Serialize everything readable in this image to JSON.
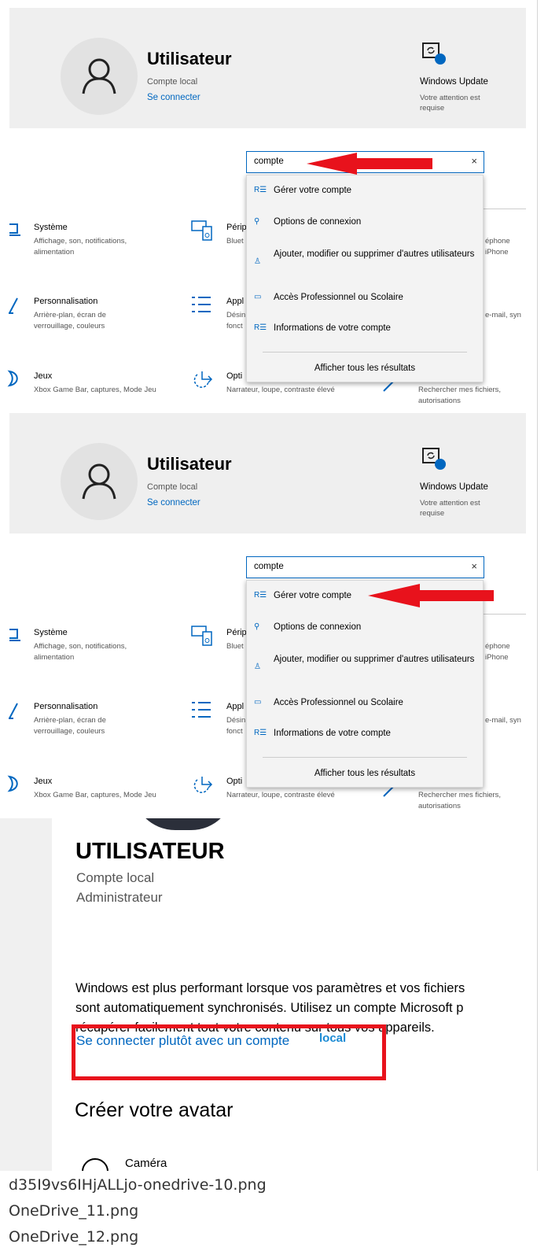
{
  "colors": {
    "accent": "#0067c0",
    "annotation": "#e8121c"
  },
  "panels": [
    {
      "user": {
        "name": "Utilisateur",
        "type": "Compte local",
        "link": "Se connecter"
      },
      "windows_update": {
        "icon": "windows-update-icon",
        "title": "Windows Update",
        "subtitle": "Votre attention est requise"
      },
      "tiles": [
        {
          "icon": "system-icon",
          "title": "Système",
          "subtitle": "Affichage, son, notifications, alimentation"
        },
        {
          "icon": "devices-icon",
          "title": "Périp",
          "subtitle": "Bluet"
        },
        {
          "icon": "phone-icon",
          "title": "éphone",
          "subtitle": "iPhone"
        },
        {
          "icon": "personalization-icon",
          "title": "Personnalisation",
          "subtitle": "Arrière-plan, écran de verrouillage, couleurs"
        },
        {
          "icon": "apps-icon",
          "title": "Appl",
          "subtitle": "Désin fonct"
        },
        {
          "icon": "accounts-icon",
          "title": "",
          "subtitle": "e-mail, syn"
        },
        {
          "icon": "gaming-icon",
          "title": "Jeux",
          "subtitle": "Xbox Game Bar, captures, Mode Jeu"
        },
        {
          "icon": "accessibility-icon",
          "title": "Opti",
          "subtitle": "Narrateur, loupe, contraste élevé"
        },
        {
          "icon": "search-icon",
          "title": "",
          "subtitle": "Rechercher mes fichiers, autorisations"
        }
      ],
      "search": {
        "value": "compte",
        "clear": "×"
      },
      "suggestions": [
        {
          "icon": "account-details-icon",
          "label": "Gérer votre compte"
        },
        {
          "icon": "key-icon",
          "label": "Options de connexion"
        },
        {
          "icon": "add-user-icon",
          "label": "Ajouter, modifier ou supprimer d'autres utilisateurs"
        },
        {
          "icon": "briefcase-icon",
          "label": "Accès Professionnel ou Scolaire"
        },
        {
          "icon": "account-details-icon",
          "label": "Informations de votre compte"
        }
      ],
      "show_all": "Afficher tous les résultats",
      "arrow_target": "search-input"
    },
    {
      "user": {
        "name": "Utilisateur",
        "type": "Compte local",
        "link": "Se connecter"
      },
      "windows_update": {
        "icon": "windows-update-icon",
        "title": "Windows Update",
        "subtitle": "Votre attention est requise"
      },
      "tiles": [
        {
          "icon": "system-icon",
          "title": "Système",
          "subtitle": "Affichage, son, notifications, alimentation"
        },
        {
          "icon": "devices-icon",
          "title": "Périp",
          "subtitle": "Bluet"
        },
        {
          "icon": "phone-icon",
          "title": "éphone",
          "subtitle": "iPhone"
        },
        {
          "icon": "personalization-icon",
          "title": "Personnalisation",
          "subtitle": "Arrière-plan, écran de verrouillage, couleurs"
        },
        {
          "icon": "apps-icon",
          "title": "Appl",
          "subtitle": "Désin fonct"
        },
        {
          "icon": "accounts-icon",
          "title": "",
          "subtitle": "e-mail, syn"
        },
        {
          "icon": "gaming-icon",
          "title": "Jeux",
          "subtitle": "Xbox Game Bar, captures, Mode Jeu"
        },
        {
          "icon": "accessibility-icon",
          "title": "Opti",
          "subtitle": "Narrateur, loupe, contraste élevé"
        },
        {
          "icon": "search-icon",
          "title": "",
          "subtitle": "Rechercher mes fichiers, autorisations"
        }
      ],
      "search": {
        "value": "compte",
        "clear": "×"
      },
      "suggestions": [
        {
          "icon": "account-details-icon",
          "label": "Gérer votre compte"
        },
        {
          "icon": "key-icon",
          "label": "Options de connexion"
        },
        {
          "icon": "add-user-icon",
          "label": "Ajouter, modifier ou supprimer d'autres utilisateurs"
        },
        {
          "icon": "briefcase-icon",
          "label": "Accès Professionnel ou Scolaire"
        },
        {
          "icon": "account-details-icon",
          "label": "Informations de votre compte"
        }
      ],
      "show_all": "Afficher tous les résultats",
      "arrow_target": "suggestion-gerer-votre-compte"
    }
  ],
  "account_page": {
    "name": "UTILISATEUR",
    "type": "Compte local",
    "role": "Administrateur",
    "paragraph": [
      "Windows est plus performant lorsque vos paramètres et vos fichiers",
      "sont automatiquement synchronisés. Utilisez un compte Microsoft p",
      "récupérer facilement tout votre contenu sur tous vos appareils."
    ],
    "signin_link": "Se connecter plutôt avec un compte",
    "signin_annotation": "local",
    "avatar_heading": "Créer votre avatar",
    "camera_label": "Caméra",
    "camera_icon": "camera-icon"
  },
  "captions": [
    "d35I9vs6IHjALLjo-onedrive-10.png",
    "OneDrive_11.png",
    "OneDrive_12.png"
  ]
}
